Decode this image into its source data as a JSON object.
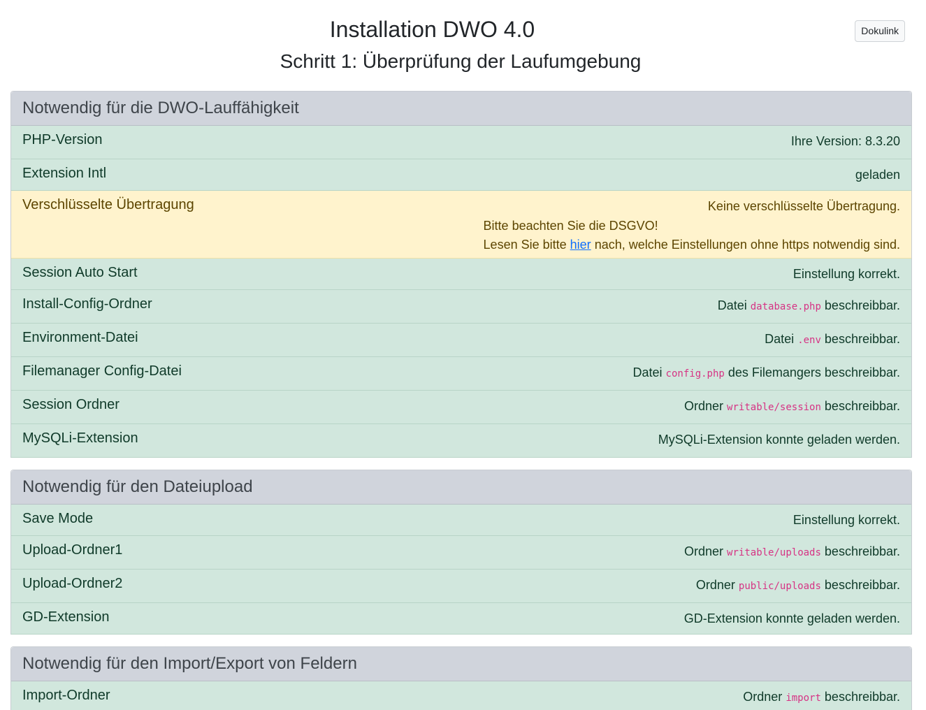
{
  "header": {
    "title": "Installation DWO 4.0",
    "subtitle": "Schritt 1: Überprüfung der Laufumgebung",
    "doc_button": "Dokulink"
  },
  "sections": [
    {
      "title": "Notwendig für die DWO-Lauffähigkeit",
      "rows": [
        {
          "label": "PHP-Version",
          "value": "Ihre Version: 8.3.20"
        },
        {
          "label": "Extension Intl",
          "value": "geladen"
        },
        {
          "label": "Verschlüsselte Übertragung",
          "warning_line1": "Keine verschlüsselte Übertragung.",
          "warning_line2": "Bitte beachten Sie die DSGVO!",
          "warning_line3_pre": "Lesen Sie bitte",
          "warning_link": "hier",
          "warning_line3_post": "nach, welche Einstellungen ohne https notwendig sind."
        },
        {
          "label": "Session Auto Start",
          "value": "Einstellung korrekt."
        },
        {
          "label": "Install-Config-Ordner",
          "pre": "Datei",
          "code": "database.php",
          "post": "beschreibbar."
        },
        {
          "label": "Environment-Datei",
          "pre": "Datei",
          "code": ".env",
          "post": "beschreibbar."
        },
        {
          "label": "Filemanager Config-Datei",
          "pre": "Datei",
          "code": "config.php",
          "post": "des Filemangers beschreibbar."
        },
        {
          "label": "Session Ordner",
          "pre": "Ordner",
          "code": "writable/session",
          "post": "beschreibbar."
        },
        {
          "label": "MySQLi-Extension",
          "value": "MySQLi-Extension konnte geladen werden."
        }
      ]
    },
    {
      "title": "Notwendig für den Dateiupload",
      "rows": [
        {
          "label": "Save Mode",
          "value": "Einstellung korrekt."
        },
        {
          "label": "Upload-Ordner1",
          "pre": "Ordner",
          "code": "writable/uploads",
          "post": "beschreibbar."
        },
        {
          "label": "Upload-Ordner2",
          "pre": "Ordner",
          "code": "public/uploads",
          "post": "beschreibbar."
        },
        {
          "label": "GD-Extension",
          "value": "GD-Extension konnte geladen werden."
        }
      ]
    },
    {
      "title": "Notwendig für den Import/Export von Feldern",
      "rows": [
        {
          "label": "Import-Ordner",
          "pre": "Ordner",
          "code": "import",
          "post": "beschreibbar."
        }
      ]
    }
  ]
}
